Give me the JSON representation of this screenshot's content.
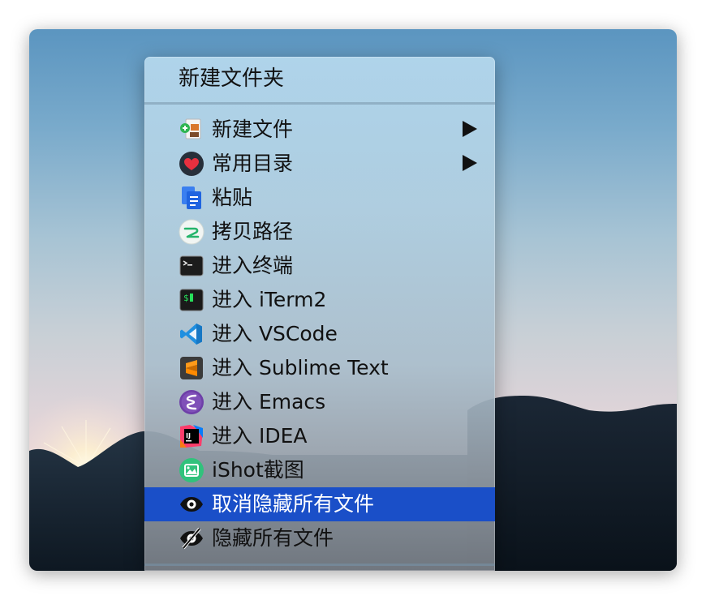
{
  "menu": {
    "header": "新建文件夹",
    "items": [
      {
        "label": "新建文件",
        "icon": "new-file-icon",
        "submenu": true
      },
      {
        "label": "常用目录",
        "icon": "heart-icon",
        "submenu": true
      },
      {
        "label": "粘贴",
        "icon": "paste-icon",
        "submenu": false
      },
      {
        "label": "拷贝路径",
        "icon": "copy-path-icon",
        "submenu": false
      },
      {
        "label": "进入终端",
        "icon": "terminal-icon",
        "submenu": false
      },
      {
        "label": "进入 iTerm2",
        "icon": "iterm2-icon",
        "submenu": false
      },
      {
        "label": "进入 VSCode",
        "icon": "vscode-icon",
        "submenu": false
      },
      {
        "label": "进入 Sublime Text",
        "icon": "sublime-text-icon",
        "submenu": false
      },
      {
        "label": "进入 Emacs",
        "icon": "emacs-icon",
        "submenu": false
      },
      {
        "label": "进入 IDEA",
        "icon": "idea-icon",
        "submenu": false
      },
      {
        "label": "iShot截图",
        "icon": "ishot-icon",
        "submenu": false
      },
      {
        "label": "取消隐藏所有文件",
        "icon": "eye-icon",
        "submenu": false,
        "selected": true
      },
      {
        "label": "隐藏所有文件",
        "icon": "eye-slash-icon",
        "submenu": false
      }
    ]
  },
  "colors": {
    "selection": "#1a4fc8",
    "text": "#111111",
    "selected_text": "#ffffff"
  }
}
